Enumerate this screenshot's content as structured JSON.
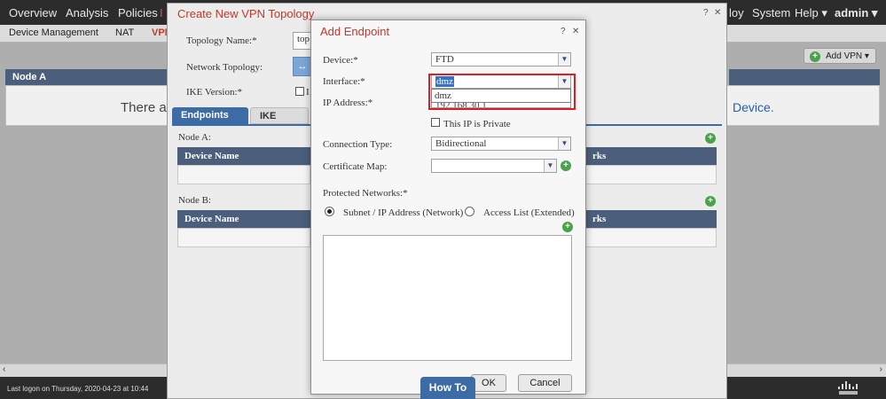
{
  "topnav": {
    "items": [
      "Overview",
      "Analysis",
      "Policies",
      "I"
    ],
    "right": [
      "loy",
      "System",
      "Help ▾",
      "admin ▾"
    ]
  },
  "subnav": {
    "items": [
      "Device Management",
      "NAT",
      "VPN"
    ]
  },
  "bg": {
    "add_vpn_label": "Add VPN ▾",
    "node_a_header": "Node A",
    "empty_left": "There ar",
    "empty_right": "Device.",
    "status_text": "Last logon on Thursday, 2020-04-23 at 10:44"
  },
  "outer_dialog": {
    "title": "Create New VPN Topology",
    "help": "?",
    "close": "✕",
    "topology_name_label": "Topology Name:*",
    "topology_name_value": "top",
    "network_topology_label": "Network Topology:",
    "network_topology_value": "↔",
    "ike_version_label": "IKE Version:*",
    "ike_version_value": "I",
    "tabs": [
      "Endpoints",
      "IKE"
    ],
    "node_a_label": "Node A:",
    "node_b_label": "Node B:",
    "col_device_name": "Device Name",
    "col_networks": "rks"
  },
  "inner_dialog": {
    "title": "Add Endpoint",
    "help": "?",
    "close": "✕",
    "device_label": "Device:*",
    "device_value": "FTD",
    "interface_label": "Interface:*",
    "interface_value": "dmz",
    "interface_option": "dmz",
    "ip_label": "IP Address:*",
    "ip_value": "192.168.30.1",
    "private_label": "This IP is Private",
    "connection_type_label": "Connection Type:",
    "connection_type_value": "Bidirectional",
    "certificate_map_label": "Certificate Map:",
    "certificate_map_value": "",
    "protected_networks_label": "Protected Networks:*",
    "radio_subnet": "Subnet / IP Address (Network)",
    "radio_acl": "Access List (Extended)",
    "ok": "OK",
    "cancel": "Cancel",
    "how_to": "How To"
  },
  "colors": {
    "highlight_box": "#e01b24",
    "title_red": "#c0392b",
    "header_blue": "#4b5f7c",
    "tab_blue": "#3d6ba5"
  }
}
